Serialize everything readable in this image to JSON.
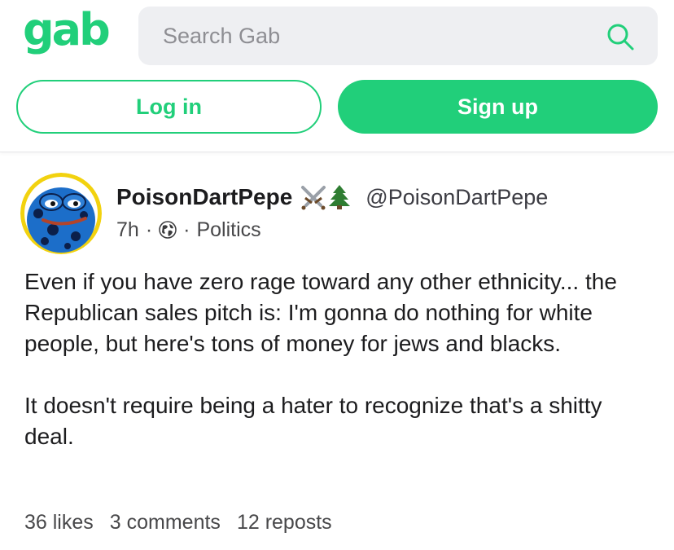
{
  "header": {
    "logo_text": "gab",
    "search": {
      "placeholder": "Search Gab",
      "value": ""
    },
    "login_label": "Log in",
    "signup_label": "Sign up",
    "brand_color": "#21cf7a"
  },
  "post": {
    "author": {
      "display_name": "PoisonDartPepe",
      "badges": [
        "crossed-swords-icon",
        "tree-icon"
      ],
      "handle": "@PoisonDartPepe"
    },
    "meta": {
      "time": "7h",
      "visibility_icon": "globe-icon",
      "separator": "·",
      "group": "Politics"
    },
    "body": {
      "paragraph_1": "Even if you have zero rage toward any other ethnicity... the Republican sales pitch is: I'm gonna do nothing for white people, but here's tons of money for jews and blacks.",
      "paragraph_2": "It doesn't require being a hater to recognize that's a shitty deal."
    },
    "stats": {
      "likes": "36 likes",
      "comments": "3 comments",
      "reposts": "12 reposts"
    }
  }
}
